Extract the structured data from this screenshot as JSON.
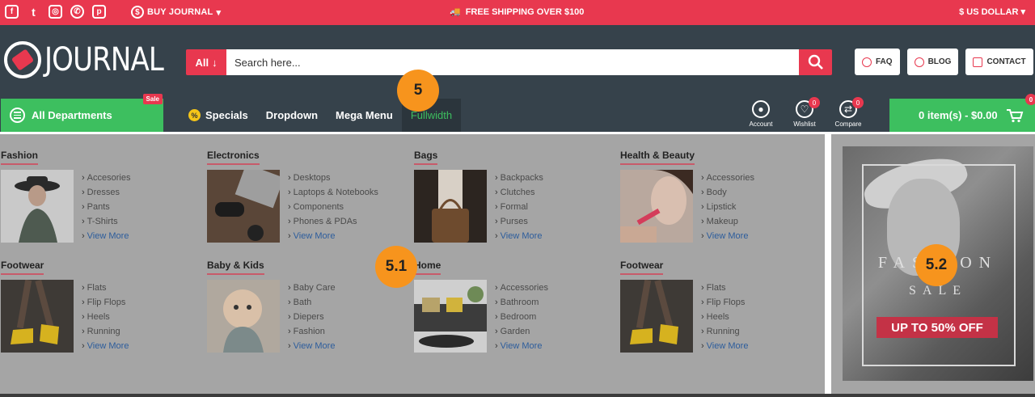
{
  "topbar": {
    "social_icons": [
      "facebook-icon",
      "twitter-icon",
      "instagram-icon",
      "whatsapp-icon",
      "pinterest-icon"
    ],
    "buy_label": "BUY JOURNAL",
    "shipping_text": "FREE SHIPPING OVER $100",
    "currency": "$ US DOLLAR",
    "color": "#e8384f"
  },
  "header": {
    "logo_text": "JOURNAL",
    "search": {
      "category": "All",
      "placeholder": "Search here..."
    },
    "buttons": [
      {
        "label": "FAQ",
        "icon": "question-icon"
      },
      {
        "label": "BLOG",
        "icon": "chat-icon"
      },
      {
        "label": "CONTACT",
        "icon": "mail-icon"
      }
    ],
    "departments_label": "All Departments",
    "sale_badge": "Sale",
    "nav": [
      "Specials",
      "Dropdown",
      "Mega Menu",
      "Fullwidth"
    ],
    "account_label": "Account",
    "wishlist_label": "Wishlist",
    "wishlist_count": "0",
    "compare_label": "Compare",
    "compare_count": "0",
    "cart_label": "0 item(s) - $0.00",
    "cart_count": "0",
    "accent": "#3dbf5f"
  },
  "mega": {
    "categories": [
      {
        "title": "Fashion",
        "items": [
          "Accesories",
          "Dresses",
          "Pants",
          "T-Shirts"
        ],
        "more": "View More"
      },
      {
        "title": "Electronics",
        "items": [
          "Desktops",
          "Laptops & Notebooks",
          "Components",
          "Phones & PDAs"
        ],
        "more": "View More"
      },
      {
        "title": "Bags",
        "items": [
          "Backpacks",
          "Clutches",
          "Formal",
          "Purses"
        ],
        "more": "View More"
      },
      {
        "title": "Health & Beauty",
        "items": [
          "Accessories",
          "Body",
          "Lipstick",
          "Makeup"
        ],
        "more": "View More"
      },
      {
        "title": "Footwear",
        "items": [
          "Flats",
          "Flip Flops",
          "Heels",
          "Running"
        ],
        "more": "View More"
      },
      {
        "title": "Baby & Kids",
        "items": [
          "Baby Care",
          "Bath",
          "Diepers",
          "Fashion"
        ],
        "more": "View More"
      },
      {
        "title": "Home",
        "items": [
          "Accessories",
          "Bathroom",
          "Bedroom",
          "Garden"
        ],
        "more": "View More"
      },
      {
        "title": "Footwear",
        "items": [
          "Flats",
          "Flip Flops",
          "Heels",
          "Running"
        ],
        "more": "View More"
      }
    ],
    "banner": {
      "title": "FASHION",
      "subtitle": "SALE",
      "offer": "UP TO 50% OFF"
    }
  },
  "markers": [
    "5",
    "5.1",
    "5.2"
  ]
}
